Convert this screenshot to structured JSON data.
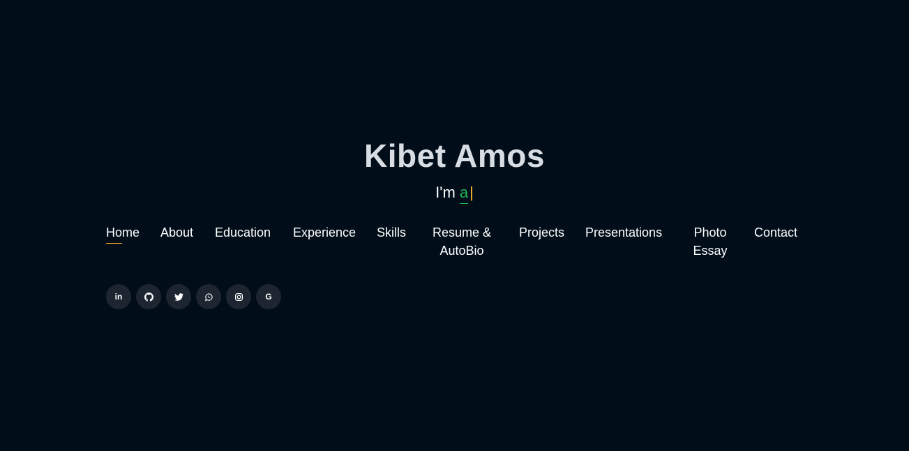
{
  "hero": {
    "name": "Kibet Amos",
    "typed_prefix": "I'm",
    "typed_word": "a",
    "cursor": "|"
  },
  "nav": {
    "items": [
      {
        "label": "Home",
        "active": true
      },
      {
        "label": "About"
      },
      {
        "label": "Education"
      },
      {
        "label": "Experience"
      },
      {
        "label": "Skills"
      },
      {
        "label": "Resume &",
        "label2": "AutoBio"
      },
      {
        "label": "Projects"
      },
      {
        "label": "Presentations"
      },
      {
        "label": "Photo",
        "label2": "Essay"
      },
      {
        "label": "Contact"
      }
    ]
  },
  "socials": [
    {
      "icon": "linkedin-icon",
      "glyph": "in"
    },
    {
      "icon": "github-icon"
    },
    {
      "icon": "twitter-icon"
    },
    {
      "icon": "whatsapp-icon"
    },
    {
      "icon": "instagram-icon"
    },
    {
      "icon": "google-icon",
      "glyph": "G"
    }
  ],
  "colors": {
    "background": "#010e1a",
    "accent_green": "#1fb856",
    "accent_yellow": "#ffb727",
    "social_bg": "#1c2530"
  }
}
